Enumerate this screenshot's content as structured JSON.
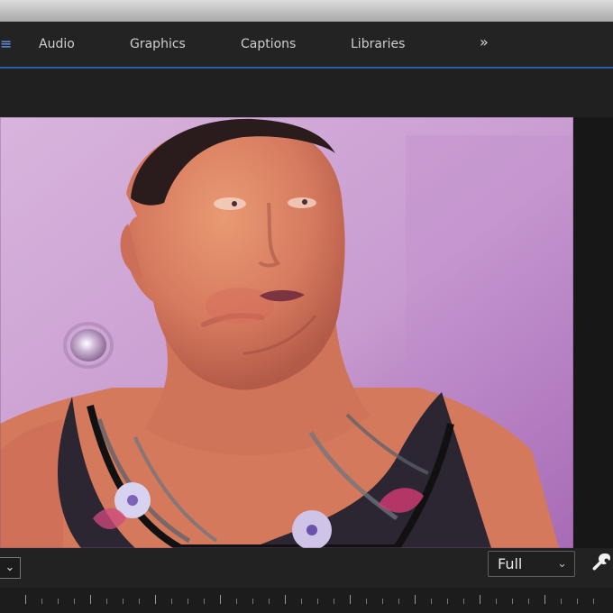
{
  "panel_tabs": {
    "items": [
      {
        "label": "Audio"
      },
      {
        "label": "Graphics"
      },
      {
        "label": "Captions"
      },
      {
        "label": "Libraries"
      }
    ],
    "overflow_icon": "double-chevron-right-icon"
  },
  "program_monitor": {
    "content": "video frame of man in tank top"
  },
  "controls": {
    "resolution_value": "Full",
    "resolution_icon": "chevron-down-icon",
    "zoom_icon": "chevron-down-icon",
    "settings_icon": "wrench-icon"
  },
  "colors": {
    "tab_underline": "#2b5fa8",
    "panel_bg": "#232323"
  }
}
